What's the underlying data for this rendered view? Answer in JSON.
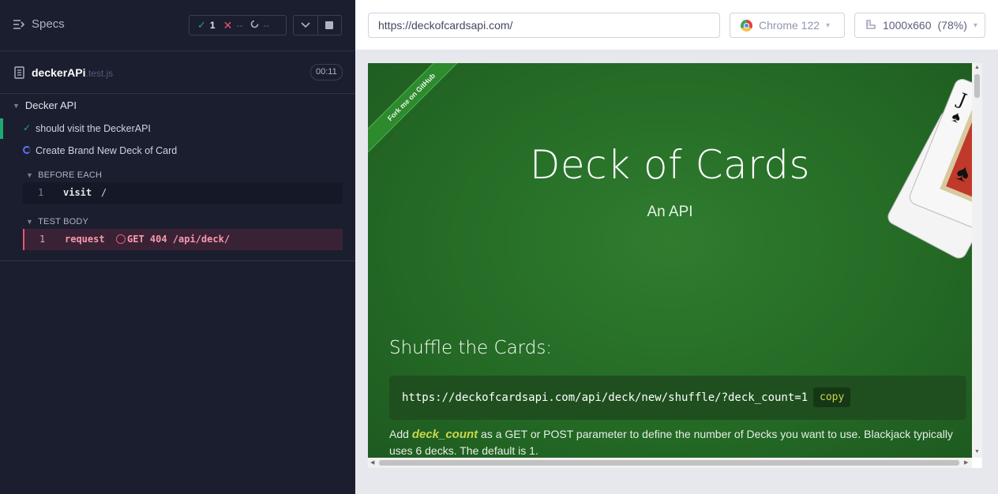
{
  "reporter": {
    "specs_label": "Specs",
    "stats": {
      "passed": "1",
      "failed": "--",
      "pending": "--"
    },
    "spec": {
      "name": "deckerAPi",
      "ext": ".test.js",
      "timer": "00:11"
    },
    "suite": "Decker API",
    "tests": [
      {
        "title": "should visit the DeckerAPI",
        "state": "passed"
      },
      {
        "title": "Create Brand New Deck of Card",
        "state": "running"
      }
    ],
    "hooks": {
      "before_each": {
        "title": "BEFORE EACH",
        "line": "1",
        "command": "visit",
        "arg": "/"
      },
      "test_body": {
        "title": "TEST BODY",
        "line": "1",
        "command": "request",
        "arg": "GET 404 /api/deck/"
      }
    }
  },
  "browser": {
    "url": "https://deckofcardsapi.com/",
    "browser_name": "Chrome 122",
    "viewport": "1000x660",
    "zoom": "(78%)"
  },
  "aut": {
    "ribbon": "Fork me on GitHub",
    "title": "Deck of Cards",
    "subtitle": "An API",
    "section_title": "Shuffle the Cards:",
    "code_url": "https://deckofcardsapi.com/api/deck/new/shuffle/?deck_count=1",
    "copy_label": "copy",
    "desc_prefix": "Add ",
    "desc_param": "deck_count",
    "desc_rest": " as a GET or POST parameter to define the number of Decks you want to use. Blackjack typically uses 6 decks. The default is 1."
  },
  "colors": {
    "reporter_bg": "#1b1e2e",
    "pass_green": "#1fa971",
    "fail_red": "#e45770",
    "aut_green": "#2f7c2f"
  }
}
